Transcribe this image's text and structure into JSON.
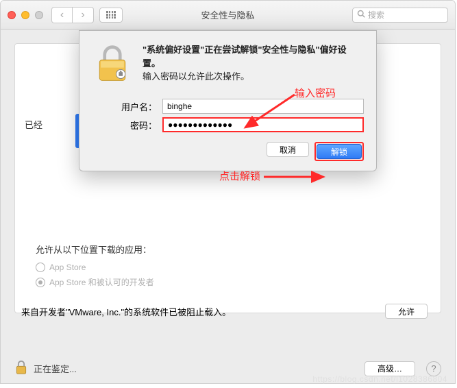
{
  "titlebar": {
    "title": "安全性与隐私",
    "search_placeholder": "搜索"
  },
  "panel": {
    "left_label": "已经",
    "download_label": "允许从以下位置下载的应用：",
    "radio_appstore": "App Store",
    "radio_identified": "App Store 和被认可的开发者",
    "blocked_text": "来自开发者\"VMware, Inc.\"的系统软件已被阻止载入。",
    "allow_button": "允许"
  },
  "footer": {
    "lock_text": "正在鉴定...",
    "advanced": "高级…"
  },
  "dialog": {
    "heading_bold": "\"系统偏好设置\"正在尝试解锁\"安全性与隐私\"偏好设置。",
    "subheading": "输入密码以允许此次操作。",
    "username_label": "用户名：",
    "username_value": "binghe",
    "password_label": "密码：",
    "password_value": "●●●●●●●●●●●●●",
    "cancel": "取消",
    "unlock": "解锁"
  },
  "annotations": {
    "a1": "输入密码",
    "a2": "点击解锁"
  },
  "watermark": "https://blog.csdn.net/l1028386804"
}
